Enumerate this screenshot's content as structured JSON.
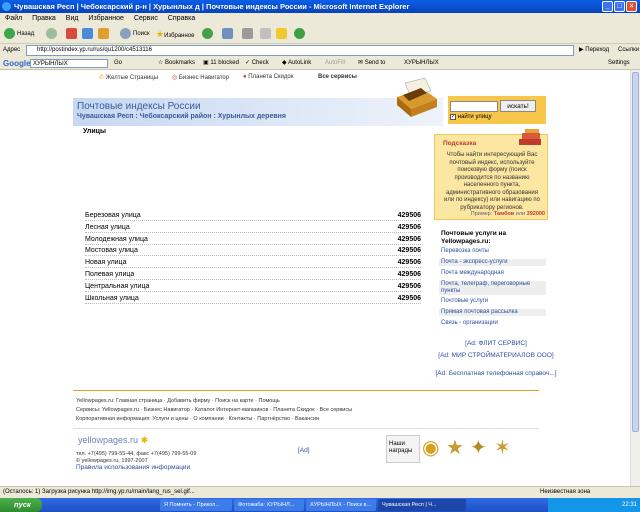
{
  "window": {
    "title": "Чувашская Респ | Чебоксарский р-н | Хурынлых д | Почтовые индексы России - Microsoft Internet Explorer"
  },
  "menu": [
    "Файл",
    "Правка",
    "Вид",
    "Избранное",
    "Сервис",
    "Справка"
  ],
  "toolbar": {
    "back": "Назад",
    "search": "Поиск",
    "favorites": "Избранное"
  },
  "address": {
    "label": "Адрес",
    "url": "http://postindex.yp.ru/rus/qu1200/c4513116",
    "go": "Переход",
    "links": "Ссылки"
  },
  "googlebar": {
    "logo": "Google",
    "query": "ХУРЫНЛЫХ",
    "go": "Go",
    "bookmarks": "Bookmarks",
    "blocked": "11 blocked",
    "check": "Check",
    "autolink": "AutoLink",
    "autofill": "AutoFill",
    "send": "Send to",
    "term": "ХУРЫНЛЫХ",
    "settings": "Settings"
  },
  "site_nav": {
    "yellow": "Желтые Страницы",
    "biz": "Бизнес Навигатор",
    "planet": "Планета Скидок",
    "all": "Все сервисы"
  },
  "page": {
    "title": "Почтовые индексы России",
    "breadcrumb": "Чувашская Респ : Чебоксарский район : Хурынлых деревня",
    "search_button": "искать!",
    "search_checkbox": "найти улицу",
    "streets_heading": "Улицы",
    "streets": [
      {
        "name": "Березовая улица",
        "zip": "429506"
      },
      {
        "name": "Лесная улица",
        "zip": "429506"
      },
      {
        "name": "Молодежная улица",
        "zip": "429506"
      },
      {
        "name": "Мостовая улица",
        "zip": "429506"
      },
      {
        "name": "Новая улица",
        "zip": "429506"
      },
      {
        "name": "Полевая улица",
        "zip": "429506"
      },
      {
        "name": "Центральная улица",
        "zip": "429506"
      },
      {
        "name": "Школьная улица",
        "zip": "429506"
      }
    ]
  },
  "hint": {
    "title": "Подсказка",
    "text": "Чтобы найти интересующий Вас почтовый индекс, используйте поисковую форму (поиск производится по названию населенного пункта, административного образования или по индексу) или навигацию по рубрикатору регионов.",
    "example_label": "Пример:",
    "example_value": "Тамбов",
    "example_sep": "или",
    "example_zip": "392000"
  },
  "services": {
    "heading": "Почтовые услуги на Yellowpages.ru:",
    "items": [
      "Перевозка почты",
      "Почта - экспресс-услуги",
      "Почта международная",
      "Почта, телеграф, переговорные пункты",
      "Почтовые услуги",
      "Прямая почтовая рассылка",
      "Связь - организации"
    ]
  },
  "ads": [
    "[Ad: ФЛИТ СЕРВИС]",
    "[Ad: МИР СТРОЙМАТЕРИАЛОВ ООО]",
    "[Ad: Бесплатная телефонная справоч...]"
  ],
  "footer": {
    "line1": "Yellowpages.ru: Главная страница · Добавить фирму · Поиск на карте · Помощь",
    "line2": "Сервисы: Yellowpages.ru · Бизнес Навигатор · Каталог Интернет-магазинов · Планета Скидок · Все сервисы",
    "line3": "Корпоративная информация: Услуги и цены · О компании · Контакты · Партнёрство · Вакансии",
    "logo": "yellowpages.ru",
    "phone": "тел. +7(495) 799-55-44, факс +7(495) 799-55-09",
    "copyright": "© yellowpages.ru, 1997-2007",
    "rules": "Правила использования информации",
    "ad": "[Ad]",
    "awards": "Наши награды"
  },
  "status": {
    "text": "(Осталось: 1) Загрузка рисунка http://img.yp.ru/main/lang_rus_sel.gif...",
    "zone": "Неизвестная зона"
  },
  "taskbar": {
    "start": "пуск",
    "tasks": [
      "Я Помнить - Прикол...",
      "Фотожаба: ХУРЫНЛ...",
      "ХУРЫНЛЫХ - Поиск в...",
      "Чувашская Респ | Ч..."
    ],
    "clock": "22:31"
  }
}
